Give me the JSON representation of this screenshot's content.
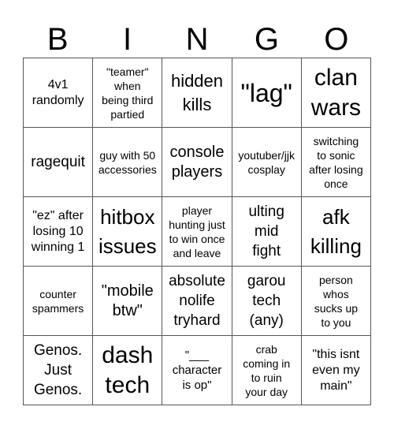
{
  "header": {
    "letters": [
      "B",
      "I",
      "N",
      "G",
      "O"
    ]
  },
  "cells": [
    "4v1\nrandomly",
    "\"teamer\"\nwhen\nbeing third\npartied",
    "hidden\nkills",
    "\"lag\"",
    "clan\nwars",
    "ragequit",
    "guy with 50\naccessories",
    "console\nplayers",
    "youtuber/jjk\ncosplay",
    "switching\nto sonic\nafter losing\nonce",
    "\"ez\" after\nlosing 10\nwinning 1",
    "hitbox\nissues",
    "player\nhunting just\nto win once\nand leave",
    "ulting\nmid\nfight",
    "afk\nkilling",
    "counter\nspammers",
    "\"mobile\nbtw\"",
    "absolute\nnolife\ntryhard",
    "garou\ntech\n(any)",
    "person\nwhos\nsucks up\nto you",
    "Genos.\nJust\nGenos.",
    "dash\ntech",
    "\"___\ncharacter\nis op\"",
    "crab\ncoming in\nto ruin\nyour day",
    "\"this isnt\neven my\nmain\""
  ]
}
